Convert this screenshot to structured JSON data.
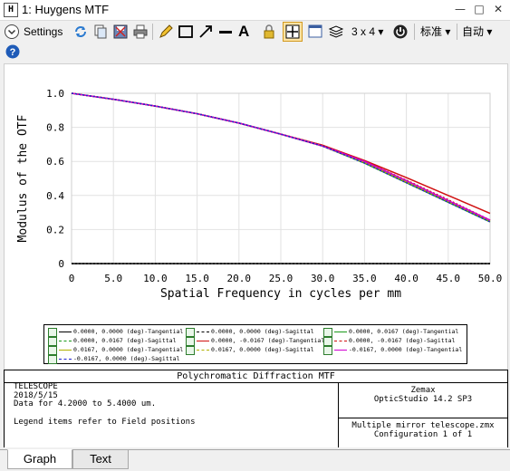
{
  "window": {
    "icon_letter": "H",
    "title": "1: Huygens MTF"
  },
  "toolbar": {
    "settings_label": "Settings",
    "layout_label": "3 x 4",
    "standard_label": "标准",
    "auto_label": "自动"
  },
  "chart_data": {
    "type": "line",
    "xlabel": "Spatial Frequency in cycles per mm",
    "ylabel": "Modulus of the OTF",
    "xlim": [
      0,
      50
    ],
    "ylim": [
      0,
      1.0
    ],
    "x_ticks": [
      "0",
      "5.0",
      "10.0",
      "15.0",
      "20.0",
      "25.0",
      "30.0",
      "35.0",
      "40.0",
      "45.0",
      "50.0"
    ],
    "y_ticks": [
      "0",
      "0.2",
      "0.4",
      "0.6",
      "0.8",
      "1.0"
    ],
    "grid": true,
    "series": [
      {
        "name": "0.0000, 0.0000 (deg)-Tangential",
        "color": "#000000",
        "dash": "",
        "x": [
          0,
          5,
          10,
          15,
          20,
          25,
          30,
          35,
          40,
          45,
          50
        ],
        "y": [
          0,
          0,
          0,
          0,
          0,
          0,
          0,
          0,
          0,
          0,
          0
        ]
      },
      {
        "name": "0.0000, 0.0000 (deg)-Sagittal",
        "color": "#000000",
        "dash": "2,2",
        "x": [
          0,
          5,
          10,
          15,
          20,
          25,
          30,
          35,
          40,
          45,
          50
        ],
        "y": [
          0,
          0,
          0,
          0,
          0,
          0,
          0,
          0,
          0,
          0,
          0
        ]
      },
      {
        "name": "0.0000, 0.0167 (deg)-Tangential",
        "color": "#1a9a1a",
        "dash": "",
        "x": [
          0,
          5,
          10,
          15,
          20,
          25,
          30,
          35,
          40,
          45,
          50
        ],
        "y": [
          1.0,
          0.965,
          0.925,
          0.88,
          0.825,
          0.76,
          0.69,
          0.59,
          0.475,
          0.36,
          0.245
        ]
      },
      {
        "name": "0.0000, 0.0167 (deg)-Sagittal",
        "color": "#1a9a1a",
        "dash": "2,2",
        "x": [
          0,
          5,
          10,
          15,
          20,
          25,
          30,
          35,
          40,
          45,
          50
        ],
        "y": [
          1.0,
          0.965,
          0.925,
          0.88,
          0.825,
          0.76,
          0.69,
          0.6,
          0.485,
          0.37,
          0.25
        ]
      },
      {
        "name": "0.0000, -0.0167 (deg)-Tangential",
        "color": "#d01010",
        "dash": "",
        "x": [
          0,
          5,
          10,
          15,
          20,
          25,
          30,
          35,
          40,
          45,
          50
        ],
        "y": [
          1.0,
          0.965,
          0.925,
          0.88,
          0.825,
          0.76,
          0.695,
          0.605,
          0.505,
          0.4,
          0.295
        ]
      },
      {
        "name": "0.0000, -0.0167 (deg)-Sagittal",
        "color": "#d01010",
        "dash": "2,2",
        "x": [
          0,
          5,
          10,
          15,
          20,
          25,
          30,
          35,
          40,
          45,
          50
        ],
        "y": [
          1.0,
          0.965,
          0.925,
          0.88,
          0.825,
          0.76,
          0.695,
          0.6,
          0.49,
          0.375,
          0.255
        ]
      },
      {
        "name": "0.0167, 0.0000 (deg)-Tangential",
        "color": "#b0b000",
        "dash": "",
        "x": [
          0,
          5,
          10,
          15,
          20,
          25,
          30,
          35,
          40,
          45,
          50
        ],
        "y": [
          1.0,
          0.965,
          0.925,
          0.88,
          0.825,
          0.76,
          0.69,
          0.595,
          0.48,
          0.365,
          0.25
        ]
      },
      {
        "name": "0.0167, 0.0000 (deg)-Sagittal",
        "color": "#b0b000",
        "dash": "2,2",
        "x": [
          0,
          5,
          10,
          15,
          20,
          25,
          30,
          35,
          40,
          45,
          50
        ],
        "y": [
          1.0,
          0.965,
          0.925,
          0.88,
          0.825,
          0.76,
          0.69,
          0.595,
          0.48,
          0.365,
          0.25
        ]
      },
      {
        "name": "-0.0167, 0.0000 (deg)-Tangential",
        "color": "#d000d0",
        "dash": "",
        "x": [
          0,
          5,
          10,
          15,
          20,
          25,
          30,
          35,
          40,
          45,
          50
        ],
        "y": [
          1.0,
          0.965,
          0.925,
          0.88,
          0.825,
          0.76,
          0.69,
          0.6,
          0.487,
          0.37,
          0.255
        ]
      },
      {
        "name": "-0.0167, 0.0000 (deg)-Sagittal",
        "color": "#2020d0",
        "dash": "2,2",
        "x": [
          0,
          5,
          10,
          15,
          20,
          25,
          30,
          35,
          40,
          45,
          50
        ],
        "y": [
          1.0,
          0.965,
          0.925,
          0.88,
          0.825,
          0.76,
          0.69,
          0.59,
          0.475,
          0.36,
          0.245
        ]
      }
    ]
  },
  "legend": [
    {
      "label": "0.0000, 0.0000 (deg)-Tangential",
      "color": "#000000",
      "dash": ""
    },
    {
      "label": "0.0000, 0.0000 (deg)-Sagittal",
      "color": "#000000",
      "dash": "2,1"
    },
    {
      "label": "0.0000, 0.0167 (deg)-Tangential",
      "color": "#1a9a1a",
      "dash": ""
    },
    {
      "label": "0.0000, 0.0167 (deg)-Sagittal",
      "color": "#1a9a1a",
      "dash": "2,1"
    },
    {
      "label": "0.0000, -0.0167 (deg)-Tangential",
      "color": "#d01010",
      "dash": ""
    },
    {
      "label": "0.0000, -0.0167 (deg)-Sagittal",
      "color": "#d01010",
      "dash": "2,1"
    },
    {
      "label": "0.0167, 0.0000 (deg)-Tangential",
      "color": "#b0b000",
      "dash": ""
    },
    {
      "label": "0.0167, 0.0000 (deg)-Sagittal",
      "color": "#b0b000",
      "dash": "2,1"
    },
    {
      "label": "-0.0167, 0.0000 (deg)-Tangential",
      "color": "#d000d0",
      "dash": ""
    },
    {
      "label": "-0.0167, 0.0000 (deg)-Sagittal",
      "color": "#2020d0",
      "dash": "2,1"
    }
  ],
  "info": {
    "header": "Polychromatic Diffraction MTF",
    "line1": "TELESCOPE",
    "line2": "2018/5/15",
    "line3": "Data for 4.2000 to 5.4000 um.",
    "line4": "Legend items refer to Field positions",
    "company": "Zemax",
    "product": "OpticStudio 14.2 SP3",
    "file": "Multiple mirror telescope.zmx",
    "config": "Configuration 1 of 1"
  },
  "tabs": [
    "Graph",
    "Text"
  ],
  "colors": {
    "accent": "#1e5bb8",
    "tab_active_bg": "#ffffff"
  }
}
